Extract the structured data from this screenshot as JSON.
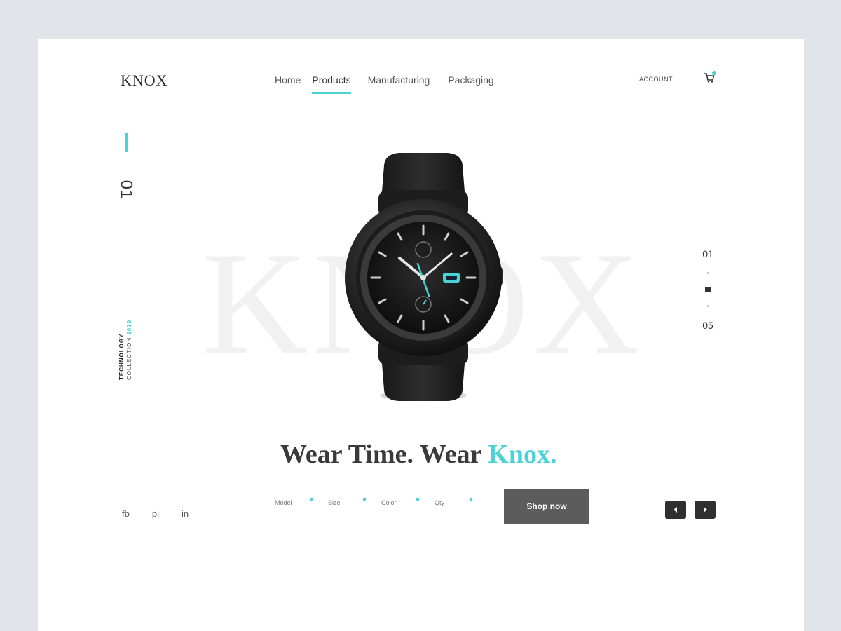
{
  "header": {
    "logo": "KNOX",
    "nav": [
      {
        "label": "Home",
        "active": false
      },
      {
        "label": "Products",
        "active": true
      },
      {
        "label": "Manufacturing",
        "active": false
      },
      {
        "label": "Packaging",
        "active": false
      }
    ],
    "account_label": "ACCOUNT",
    "cart_icon": "cart-icon"
  },
  "hero": {
    "slide_number": "01",
    "collection_label": "TECHNOLOGY",
    "collection_sub": "COLLECTION",
    "collection_year": "2019",
    "watermark": "KNOX",
    "pager_top": "01",
    "pager_bottom": "05"
  },
  "tagline": {
    "part1": "Wear Time. Wear ",
    "accent": "Knox."
  },
  "product_options": [
    {
      "label": "Model"
    },
    {
      "label": "Size"
    },
    {
      "label": "Color"
    },
    {
      "label": "Qty"
    }
  ],
  "shop_button": "Shop now",
  "social": [
    "fb",
    "pi",
    "in"
  ],
  "colors": {
    "accent": "#49d3d6",
    "button": "#5c5c5c",
    "background": "#e1e4e9"
  }
}
